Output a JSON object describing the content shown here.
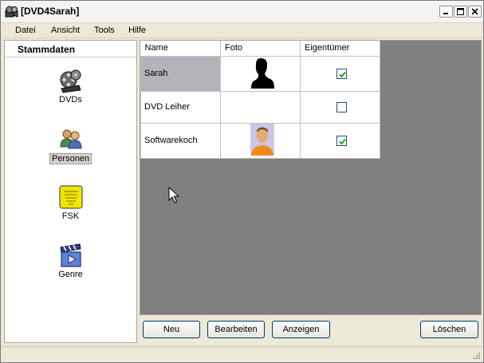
{
  "window": {
    "title": "[DVD4Sarah]"
  },
  "menu": [
    "Datei",
    "Ansicht",
    "Tools",
    "Hilfe"
  ],
  "sidebar": {
    "header": "Stammdaten",
    "items": [
      {
        "label": "DVDs",
        "icon": "film-reel-icon"
      },
      {
        "label": "Personen",
        "icon": "people-icon",
        "selected": true
      },
      {
        "label": "FSK",
        "icon": "fsk-rating-icon"
      },
      {
        "label": "Genre",
        "icon": "clapperboard-icon"
      }
    ]
  },
  "grid": {
    "columns": [
      "Name",
      "Foto",
      "Eigentümer"
    ],
    "rows": [
      {
        "name": "Sarah",
        "photo": "silhouette",
        "owner": true,
        "selected": true
      },
      {
        "name": "DVD Leiher",
        "photo": "none",
        "owner": false
      },
      {
        "name": "Softwarekoch",
        "photo": "portrait",
        "owner": true
      }
    ]
  },
  "buttons": {
    "new": "Neu",
    "edit": "Bearbeiten",
    "show": "Anzeigen",
    "delete": "Löschen"
  },
  "colors": {
    "grid_background": "#808080",
    "selection": "#b3b3b9",
    "checkmark": "#21a121"
  }
}
